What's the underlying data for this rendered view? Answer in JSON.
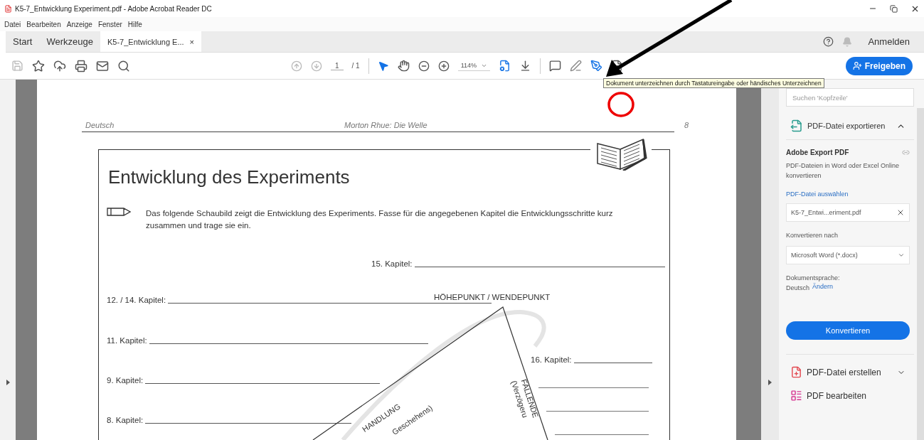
{
  "window": {
    "title": "K5-7_Entwicklung Experiment.pdf - Adobe Acrobat Reader DC"
  },
  "menu": [
    "Datei",
    "Bearbeiten",
    "Anzeige",
    "Fenster",
    "Hilfe"
  ],
  "tabs": [
    {
      "label": "Start",
      "selected": false
    },
    {
      "label": "Werkzeuge",
      "selected": false
    },
    {
      "label": "K5-7_Entwicklung E...",
      "selected": true,
      "close": "×"
    }
  ],
  "account": {
    "label": "Anmelden"
  },
  "toolbar": {
    "page_current": "1",
    "page_total": "/ 1",
    "zoom": "114%",
    "share_button": "Freigeben"
  },
  "tooltip": "Dokument unterzeichnen durch Tastatureingabe oder händisches Unterzeichnen",
  "document": {
    "header_left": "Deutsch",
    "header_center": "Morton Rhue: Die Welle",
    "page_number": "8",
    "title": "Entwicklung des Experiments",
    "instruction": "Das folgende Schaubild zeigt die Entwicklung des Experiments. Fasse für die angegebenen Kapitel die Entwicklungsschritte kurz zusammen und trage sie ein.",
    "chapter_fields": [
      {
        "label": "15. Kapitel:"
      },
      {
        "label": "12. / 14. Kapitel:"
      },
      {
        "label": "11. Kapitel:"
      },
      {
        "label": "16. Kapitel:"
      },
      {
        "label": "9. Kapitel:"
      },
      {
        "label": "8. Kapitel:"
      }
    ],
    "peak": "HÖHEPUNKT / WENDEPUNKT",
    "rising": [
      "HANDLUNG",
      "Geschehens)"
    ],
    "falling": [
      "FALLENDE",
      "(Verzögeru"
    ]
  },
  "panel": {
    "search_placeholder": "Suchen 'Kopfzeile'",
    "export_title": "PDF-Datei exportieren",
    "service": "Adobe Export PDF",
    "description": "PDF-Dateien in Word oder Excel Online konvertieren",
    "select_link": "PDF-Datei auswählen",
    "file": "K5-7_Entwi...eriment.pdf",
    "convert_label": "Konvertieren nach",
    "format": "Microsoft Word (*.docx)",
    "language_label": "Dokumentsprache:",
    "language": "Deutsch",
    "change_link": "Ändern",
    "convert_button": "Konvertieren",
    "tools": [
      "PDF-Datei erstellen",
      "PDF bearbeiten"
    ]
  }
}
